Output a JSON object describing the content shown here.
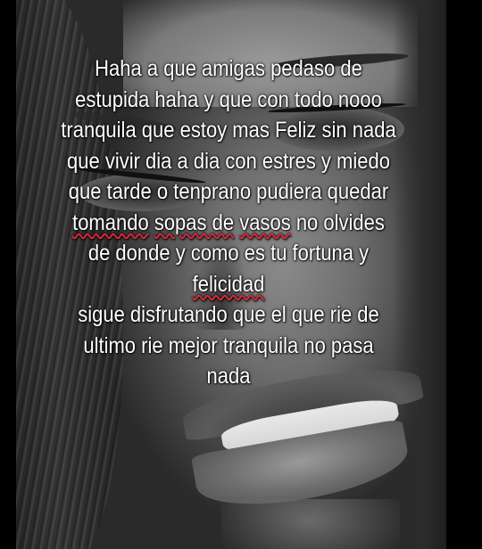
{
  "caption": {
    "lines": [
      {
        "segments": [
          {
            "text": "Haha a que amigas pedaso de"
          }
        ]
      },
      {
        "segments": [
          {
            "text": "estupida haha y que con todo nooo"
          }
        ]
      },
      {
        "segments": [
          {
            "text": "tranquila que estoy mas Feliz sin nada"
          }
        ]
      },
      {
        "segments": [
          {
            "text": "que vivir dia a dia con estres y miedo"
          }
        ]
      },
      {
        "segments": [
          {
            "text": "que tarde o tenprano  pudiera quedar"
          }
        ]
      },
      {
        "segments": [
          {
            "text": "tomando",
            "spell": true
          },
          {
            "text": " "
          },
          {
            "text": "sopas de",
            "spell": true
          },
          {
            "text": " "
          },
          {
            "text": "vasos",
            "spell": true
          },
          {
            "text": "  no olvides"
          }
        ]
      },
      {
        "segments": [
          {
            "text": "de donde y como es tu fortuna y"
          }
        ]
      },
      {
        "segments": [
          {
            "text": "felicidad",
            "spell": true
          }
        ]
      },
      {
        "segments": [
          {
            "text": " sigue disfrutando que el que rie de"
          }
        ]
      },
      {
        "segments": [
          {
            "text": "ultimo rie mejor tranquila no pasa"
          }
        ]
      },
      {
        "segments": [
          {
            "text": "nada"
          }
        ]
      }
    ]
  },
  "colors": {
    "text": "#ffffff",
    "spellcheck_underline": "#e0283c",
    "background": "#000000"
  }
}
